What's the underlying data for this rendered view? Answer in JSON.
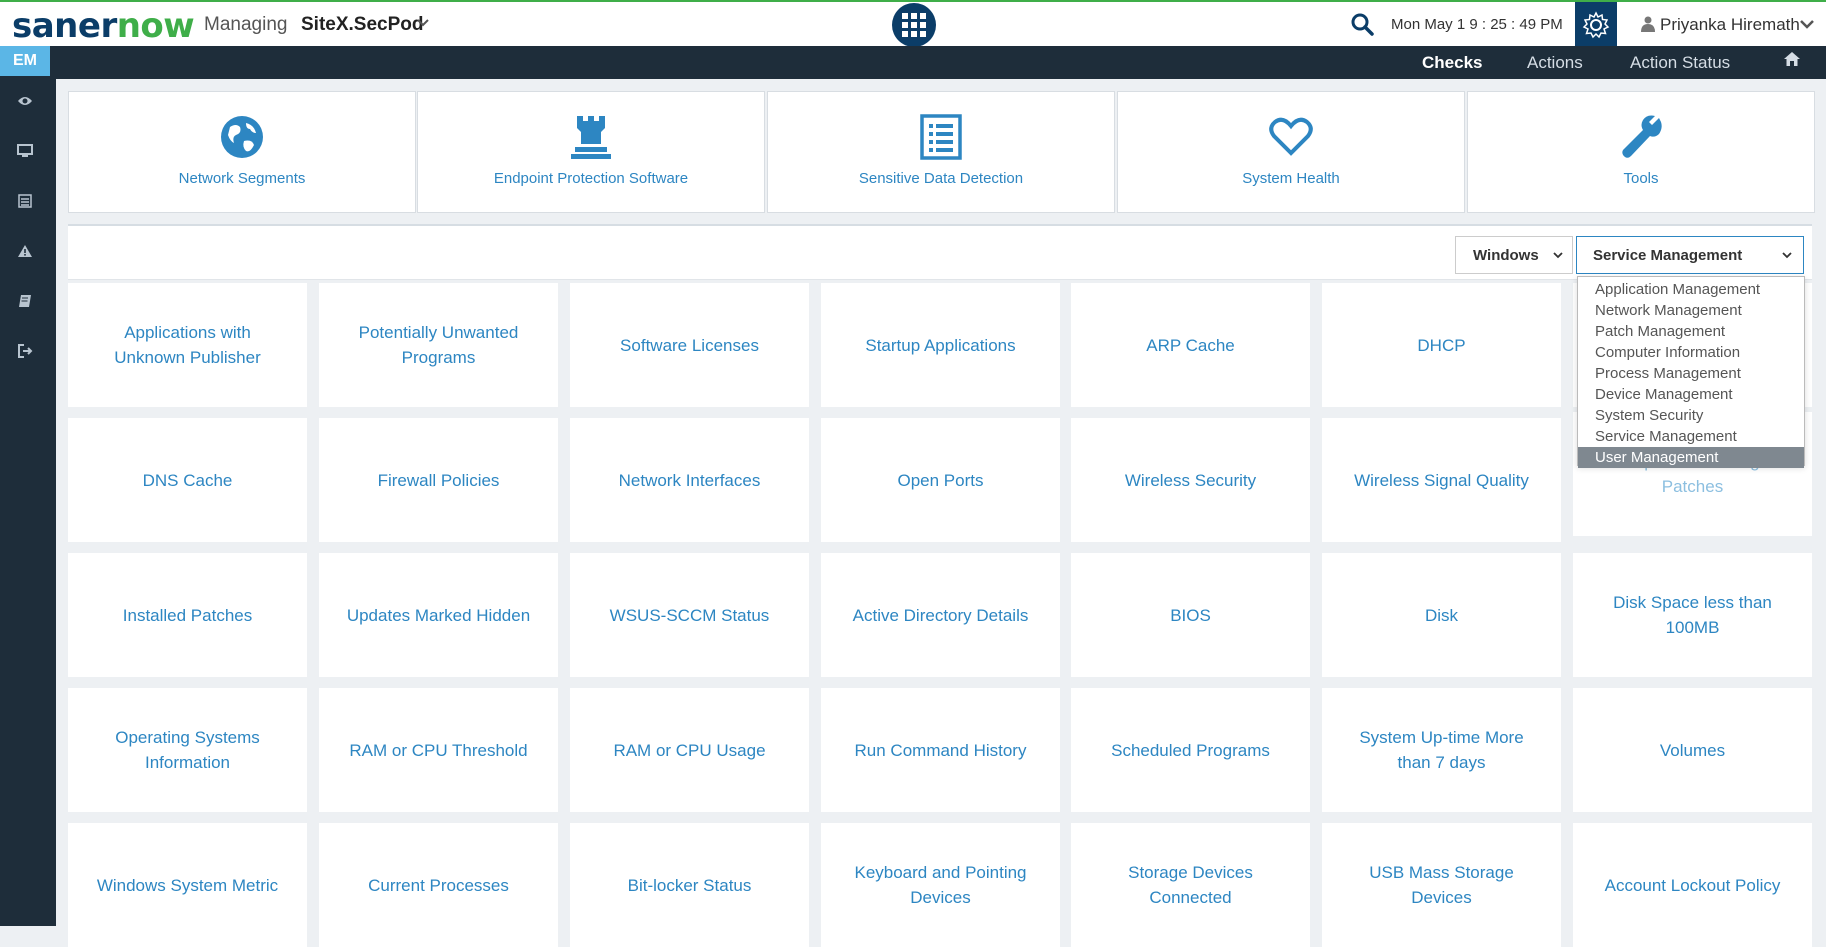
{
  "header": {
    "logo_part1": "saner",
    "logo_part2": "now",
    "managing_label": "Managing",
    "site": "SiteX.SecPod",
    "datetime": "Mon May 1   9 : 25 : 49 PM",
    "user": "Priyanka Hiremath"
  },
  "sidebar": {
    "badge": "EM",
    "icons": [
      "eye-icon",
      "monitor-icon",
      "list-icon",
      "warning-icon",
      "book-icon",
      "logout-icon"
    ]
  },
  "nav": {
    "checks": "Checks",
    "actions": "Actions",
    "action_status": "Action Status"
  },
  "categories": [
    {
      "label": "Network Segments",
      "icon": "globe-icon"
    },
    {
      "label": "Endpoint Protection Software",
      "icon": "castle-icon"
    },
    {
      "label": "Sensitive Data Detection",
      "icon": "document-list-icon"
    },
    {
      "label": "System Health",
      "icon": "heart-icon"
    },
    {
      "label": "Tools",
      "icon": "wrench-icon"
    }
  ],
  "filters": {
    "os": "Windows",
    "category": "Service Management"
  },
  "dropdown": {
    "options": [
      "Application Management",
      "Network Management",
      "Patch Management",
      "Computer Information",
      "Process Management",
      "Device Management",
      "System Security",
      "Service Management",
      "User Management"
    ],
    "highlighted": "User Management"
  },
  "checks": [
    [
      "Applications with",
      "Unknown Publisher"
    ],
    [
      "Potentially Unwanted",
      "Programs"
    ],
    [
      "Software Licenses"
    ],
    [
      "Startup Applications"
    ],
    [
      "ARP Cache"
    ],
    [
      "DHCP"
    ],
    [
      ""
    ],
    [
      "DNS Cache"
    ],
    [
      "Firewall Policies"
    ],
    [
      "Network Interfaces"
    ],
    [
      "Open Ports"
    ],
    [
      "Wireless Security"
    ],
    [
      "Wireless Signal Quality"
    ],
    [
      "Important Missing",
      "Patches"
    ],
    [
      "Installed Patches"
    ],
    [
      "Updates Marked Hidden"
    ],
    [
      "WSUS-SCCM Status"
    ],
    [
      "Active Directory Details"
    ],
    [
      "BIOS"
    ],
    [
      "Disk"
    ],
    [
      "Disk Space less than",
      "100MB"
    ],
    [
      "Operating Systems",
      "Information"
    ],
    [
      "RAM or CPU Threshold"
    ],
    [
      "RAM or CPU Usage"
    ],
    [
      "Run Command History"
    ],
    [
      "Scheduled Programs"
    ],
    [
      "System Up-time More",
      "than 7 days"
    ],
    [
      "Volumes"
    ],
    [
      "Windows System Metric"
    ],
    [
      "Current Processes"
    ],
    [
      "Bit-locker Status"
    ],
    [
      "Keyboard and Pointing",
      "Devices"
    ],
    [
      "Storage Devices",
      "Connected"
    ],
    [
      "USB Mass Storage",
      "Devices"
    ],
    [
      "Account Lockout Policy"
    ]
  ]
}
